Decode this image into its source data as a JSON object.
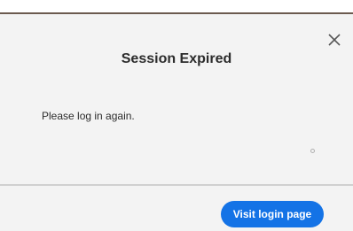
{
  "dialog": {
    "title": "Session Expired",
    "message": "Please log in again.",
    "close_icon": "close-icon",
    "primary_button_label": "Visit login page"
  },
  "colors": {
    "background": "#f3f3f3",
    "top_border": "#6b5a4e",
    "accent": "#1473e6",
    "text": "#2c2c2c",
    "divider": "#d0d0d0"
  }
}
